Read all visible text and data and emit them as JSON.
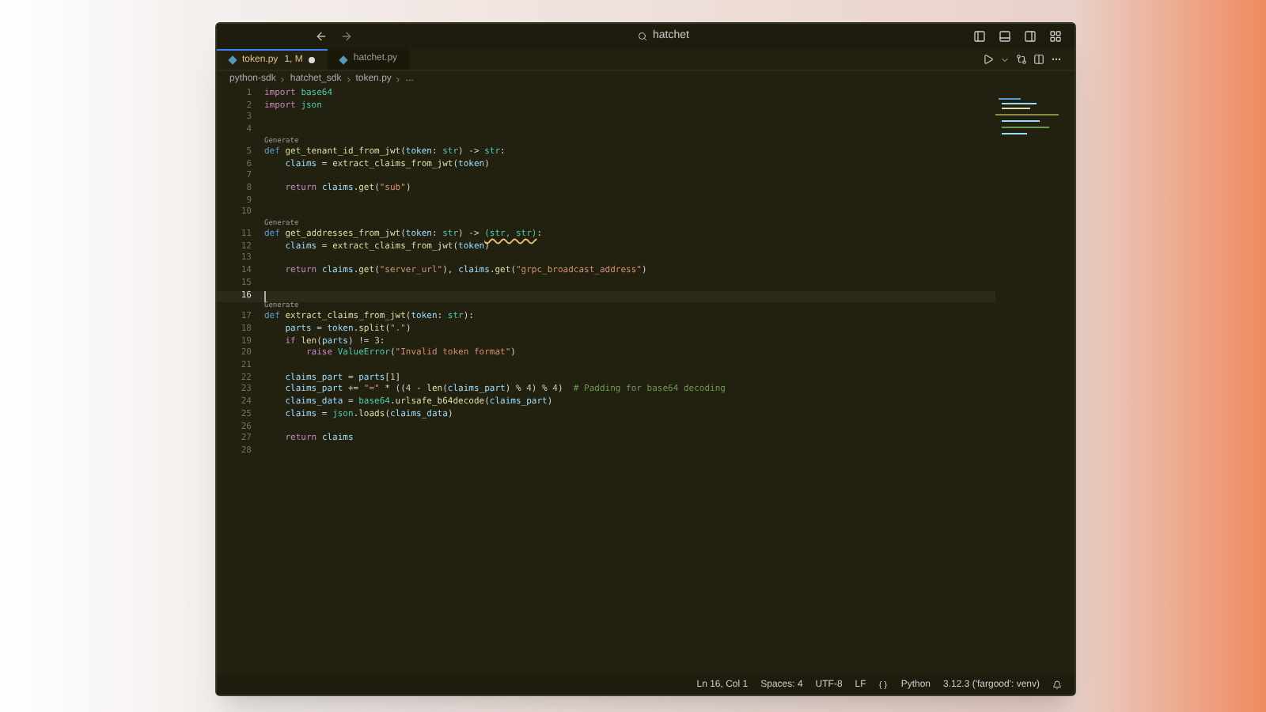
{
  "window": {
    "title": "hatchet"
  },
  "tabs": [
    {
      "label": "token.py",
      "badge": "1, M",
      "modified": true,
      "selected": true
    },
    {
      "label": "hatchet.py",
      "modified": false,
      "selected": false
    }
  ],
  "breadcrumbs": [
    "python-sdk",
    "hatchet_sdk",
    "token.py",
    "..."
  ],
  "lines": [
    {
      "number": "1",
      "current": false,
      "tokens": [
        {
          "kind": "kw2",
          "text": "import "
        },
        {
          "kind": "type",
          "text": "base64"
        }
      ]
    },
    {
      "number": "2",
      "current": false,
      "tokens": [
        {
          "kind": "kw2",
          "text": "import "
        },
        {
          "kind": "type",
          "text": "json"
        }
      ]
    },
    {
      "number": "3",
      "current": false
    },
    {
      "number": "4",
      "current": false
    },
    {
      "number": "5",
      "current": false,
      "codelens": "Generate",
      "tokens": [
        {
          "kind": "kw",
          "text": "def "
        },
        {
          "kind": "fn",
          "text": "get_tenant_id_from_jwt"
        },
        {
          "kind": "plain",
          "text": "("
        },
        {
          "kind": "var",
          "text": "token"
        },
        {
          "kind": "plain",
          "text": ": "
        },
        {
          "kind": "type",
          "text": "str"
        },
        {
          "kind": "plain",
          "text": ") -> "
        },
        {
          "kind": "type",
          "text": "str"
        },
        {
          "kind": "plain",
          "text": ":"
        }
      ]
    },
    {
      "number": "6",
      "current": false,
      "tokens": [
        {
          "kind": "var",
          "text": "    claims"
        },
        {
          "kind": "plain",
          "text": " = "
        },
        {
          "kind": "fn",
          "text": "extract_claims_from_jwt"
        },
        {
          "kind": "plain",
          "text": "("
        },
        {
          "kind": "var",
          "text": "token"
        },
        {
          "kind": "plain",
          "text": ")"
        }
      ]
    },
    {
      "number": "7",
      "current": false
    },
    {
      "number": "8",
      "current": false,
      "tokens": [
        {
          "kind": "kw2",
          "text": "    return "
        },
        {
          "kind": "var",
          "text": "claims"
        },
        {
          "kind": "plain",
          "text": "."
        },
        {
          "kind": "fn",
          "text": "get"
        },
        {
          "kind": "plain",
          "text": "("
        },
        {
          "kind": "str",
          "text": "\"sub\""
        },
        {
          "kind": "plain",
          "text": ")"
        }
      ]
    },
    {
      "number": "9",
      "current": false
    },
    {
      "number": "10",
      "current": false
    },
    {
      "number": "11",
      "current": false,
      "codelens": "Generate",
      "tokens": [
        {
          "kind": "kw",
          "text": "def "
        },
        {
          "kind": "fn",
          "text": "get_addresses_from_jwt"
        },
        {
          "kind": "plain",
          "text": "("
        },
        {
          "kind": "var",
          "text": "token"
        },
        {
          "kind": "plain",
          "text": ": "
        },
        {
          "kind": "type",
          "text": "str"
        },
        {
          "kind": "plain",
          "text": ") -> "
        },
        {
          "kind": "warn",
          "text": "(str, str)"
        },
        {
          "kind": "plain",
          "text": ":"
        }
      ]
    },
    {
      "number": "12",
      "current": false,
      "tokens": [
        {
          "kind": "var",
          "text": "    claims"
        },
        {
          "kind": "plain",
          "text": " = "
        },
        {
          "kind": "fn",
          "text": "extract_claims_from_jwt"
        },
        {
          "kind": "plain",
          "text": "("
        },
        {
          "kind": "var",
          "text": "token"
        },
        {
          "kind": "plain",
          "text": ")"
        }
      ]
    },
    {
      "number": "13",
      "current": false
    },
    {
      "number": "14",
      "current": false,
      "tokens": [
        {
          "kind": "kw2",
          "text": "    return "
        },
        {
          "kind": "var",
          "text": "claims"
        },
        {
          "kind": "plain",
          "text": "."
        },
        {
          "kind": "fn",
          "text": "get"
        },
        {
          "kind": "plain",
          "text": "("
        },
        {
          "kind": "str",
          "text": "\"server_url\""
        },
        {
          "kind": "plain",
          "text": "), "
        },
        {
          "kind": "var",
          "text": "claims"
        },
        {
          "kind": "plain",
          "text": "."
        },
        {
          "kind": "fn",
          "text": "get"
        },
        {
          "kind": "plain",
          "text": "("
        },
        {
          "kind": "str",
          "text": "\"grpc_broadcast_address\""
        },
        {
          "kind": "plain",
          "text": ")"
        }
      ]
    },
    {
      "number": "15",
      "current": false
    },
    {
      "number": "16",
      "current": true
    },
    {
      "number": "17",
      "current": false,
      "codelens": "Generate",
      "tokens": [
        {
          "kind": "kw",
          "text": "def "
        },
        {
          "kind": "fn",
          "text": "extract_claims_from_jwt"
        },
        {
          "kind": "plain",
          "text": "("
        },
        {
          "kind": "var",
          "text": "token"
        },
        {
          "kind": "plain",
          "text": ": "
        },
        {
          "kind": "type",
          "text": "str"
        },
        {
          "kind": "plain",
          "text": "):"
        }
      ]
    },
    {
      "number": "18",
      "current": false,
      "tokens": [
        {
          "kind": "var",
          "text": "    parts"
        },
        {
          "kind": "plain",
          "text": " = "
        },
        {
          "kind": "var",
          "text": "token"
        },
        {
          "kind": "plain",
          "text": "."
        },
        {
          "kind": "fn",
          "text": "split"
        },
        {
          "kind": "plain",
          "text": "("
        },
        {
          "kind": "str",
          "text": "\".\""
        },
        {
          "kind": "plain",
          "text": ")"
        }
      ]
    },
    {
      "number": "19",
      "current": false,
      "tokens": [
        {
          "kind": "kw2",
          "text": "    if "
        },
        {
          "kind": "fn",
          "text": "len"
        },
        {
          "kind": "plain",
          "text": "("
        },
        {
          "kind": "var",
          "text": "parts"
        },
        {
          "kind": "plain",
          "text": ") != "
        },
        {
          "kind": "num",
          "text": "3"
        },
        {
          "kind": "plain",
          "text": ":"
        }
      ]
    },
    {
      "number": "20",
      "current": false,
      "tokens": [
        {
          "kind": "kw2",
          "text": "        raise "
        },
        {
          "kind": "type",
          "text": "ValueError"
        },
        {
          "kind": "plain",
          "text": "("
        },
        {
          "kind": "str",
          "text": "\"Invalid token format\""
        },
        {
          "kind": "plain",
          "text": ")"
        }
      ]
    },
    {
      "number": "21",
      "current": false
    },
    {
      "number": "22",
      "current": false,
      "tokens": [
        {
          "kind": "var",
          "text": "    claims_part"
        },
        {
          "kind": "plain",
          "text": " = "
        },
        {
          "kind": "var",
          "text": "parts"
        },
        {
          "kind": "plain",
          "text": "["
        },
        {
          "kind": "num",
          "text": "1"
        },
        {
          "kind": "plain",
          "text": "]"
        }
      ]
    },
    {
      "number": "23",
      "current": false,
      "tokens": [
        {
          "kind": "var",
          "text": "    claims_part"
        },
        {
          "kind": "plain",
          "text": " += "
        },
        {
          "kind": "str",
          "text": "\"=\""
        },
        {
          "kind": "plain",
          "text": " * (("
        },
        {
          "kind": "num",
          "text": "4"
        },
        {
          "kind": "plain",
          "text": " - "
        },
        {
          "kind": "fn",
          "text": "len"
        },
        {
          "kind": "plain",
          "text": "("
        },
        {
          "kind": "var",
          "text": "claims_part"
        },
        {
          "kind": "plain",
          "text": ") % "
        },
        {
          "kind": "num",
          "text": "4"
        },
        {
          "kind": "plain",
          "text": ") % "
        },
        {
          "kind": "num",
          "text": "4"
        },
        {
          "kind": "plain",
          "text": ")  "
        },
        {
          "kind": "comment",
          "text": "# Padding for base64 decoding"
        }
      ]
    },
    {
      "number": "24",
      "current": false,
      "tokens": [
        {
          "kind": "var",
          "text": "    claims_data"
        },
        {
          "kind": "plain",
          "text": " = "
        },
        {
          "kind": "type",
          "text": "base64"
        },
        {
          "kind": "plain",
          "text": "."
        },
        {
          "kind": "fn",
          "text": "urlsafe_b64decode"
        },
        {
          "kind": "plain",
          "text": "("
        },
        {
          "kind": "var",
          "text": "claims_part"
        },
        {
          "kind": "plain",
          "text": ")"
        }
      ]
    },
    {
      "number": "25",
      "current": false,
      "tokens": [
        {
          "kind": "var",
          "text": "    claims"
        },
        {
          "kind": "plain",
          "text": " = "
        },
        {
          "kind": "type",
          "text": "json"
        },
        {
          "kind": "plain",
          "text": "."
        },
        {
          "kind": "fn",
          "text": "loads"
        },
        {
          "kind": "plain",
          "text": "("
        },
        {
          "kind": "var",
          "text": "claims_data"
        },
        {
          "kind": "plain",
          "text": ")"
        }
      ]
    },
    {
      "number": "26",
      "current": false
    },
    {
      "number": "27",
      "current": false,
      "tokens": [
        {
          "kind": "kw2",
          "text": "    return "
        },
        {
          "kind": "var",
          "text": "claims"
        }
      ]
    },
    {
      "number": "28",
      "current": false
    }
  ],
  "status_bar": {
    "position": "Ln 16, Col 1",
    "spaces": "Spaces: 4",
    "encoding": "UTF-8",
    "eol": "LF",
    "language": "Python",
    "interpreter": "3.12.3 ('fargood': venv)"
  }
}
